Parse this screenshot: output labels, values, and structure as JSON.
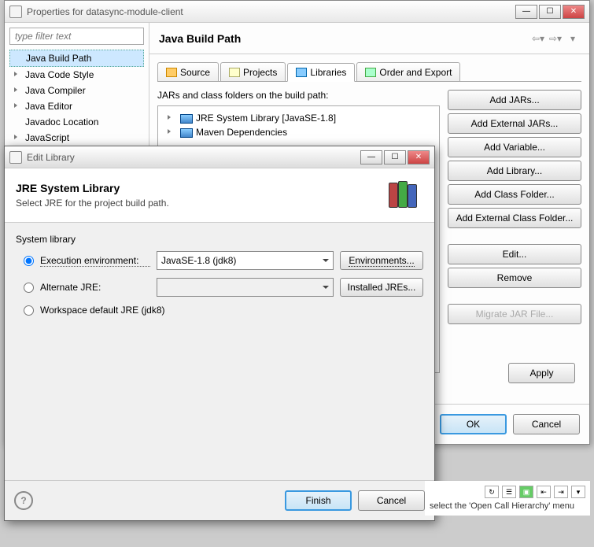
{
  "props_window": {
    "title": "Properties for datasync-module-client",
    "filter_placeholder": "type filter text",
    "tree": [
      {
        "label": "Java Build Path",
        "selected": true,
        "arrow": false
      },
      {
        "label": "Java Code Style",
        "arrow": true
      },
      {
        "label": "Java Compiler",
        "arrow": true
      },
      {
        "label": "Java Editor",
        "arrow": true
      },
      {
        "label": "Javadoc Location",
        "arrow": false
      },
      {
        "label": "JavaScript",
        "arrow": true
      }
    ],
    "page_title": "Java Build Path",
    "tabs": [
      {
        "label": "Source"
      },
      {
        "label": "Projects"
      },
      {
        "label": "Libraries",
        "active": true
      },
      {
        "label": "Order and Export"
      }
    ],
    "jars_label": "JARs and class folders on the build path:",
    "jars_nodes": [
      {
        "label": "JRE System Library [JavaSE-1.8]"
      },
      {
        "label": "Maven Dependencies"
      }
    ],
    "buttons": {
      "add_jars": "Add JARs...",
      "add_ext_jars": "Add External JARs...",
      "add_var": "Add Variable...",
      "add_lib": "Add Library...",
      "add_class": "Add Class Folder...",
      "add_ext_class": "Add External Class Folder...",
      "edit": "Edit...",
      "remove": "Remove",
      "migrate": "Migrate JAR File...",
      "apply": "Apply",
      "ok": "OK",
      "cancel": "Cancel"
    }
  },
  "edit_dialog": {
    "win_title": "Edit Library",
    "title": "JRE System Library",
    "desc": "Select JRE for the project build path.",
    "group_label": "System library",
    "radios": {
      "exec_env": "Execution environment:",
      "alt_jre": "Alternate JRE:",
      "workspace": "Workspace default JRE (jdk8)"
    },
    "exec_env_value": "JavaSE-1.8 (jdk8)",
    "btn_env": "Environments...",
    "btn_installed": "Installed JREs...",
    "finish": "Finish",
    "cancel": "Cancel"
  },
  "bottom_snippet": "select the 'Open Call Hierarchy' menu"
}
